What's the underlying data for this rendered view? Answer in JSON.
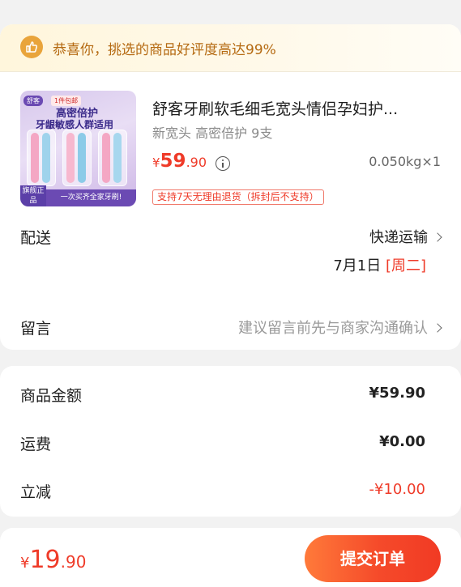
{
  "banner": {
    "text": "恭喜你，挑选的商品好评度高达99%",
    "icon": "thumbs-up-icon"
  },
  "product": {
    "image": {
      "logo": "舒客",
      "tag": "1件包邮",
      "headline1": "高密倍护",
      "headline2": "牙龈敏感人群适用",
      "flag": "旗舰正品",
      "slogan": "一次买齐全家牙刷!"
    },
    "title": "舒客牙刷软毛细毛宽头情侣孕妇护...",
    "spec": "新宽头 高密倍护 9支",
    "price_symbol": "¥",
    "price_int": "59",
    "price_dec": ".90",
    "quantity": "0.050kg×1",
    "policy": "支持7天无理由退货（拆封后不支持）"
  },
  "delivery": {
    "label": "配送",
    "method": "快递运输",
    "date": "7月1日",
    "weekday": "[周二]"
  },
  "message": {
    "label": "留言",
    "hint": "建议留言前先与商家沟通确认"
  },
  "fees": {
    "goods_label": "商品金额",
    "goods_value": "¥59.90",
    "shipping_label": "运费",
    "shipping_value": "¥0.00",
    "discount_label": "立减",
    "discount_value": "-¥10.00"
  },
  "footer": {
    "total_symbol": "¥",
    "total_int": "19",
    "total_dec": ".90",
    "submit_label": "提交订单"
  },
  "colors": {
    "accent": "#ef3b29",
    "banner_text": "#b56a12"
  }
}
